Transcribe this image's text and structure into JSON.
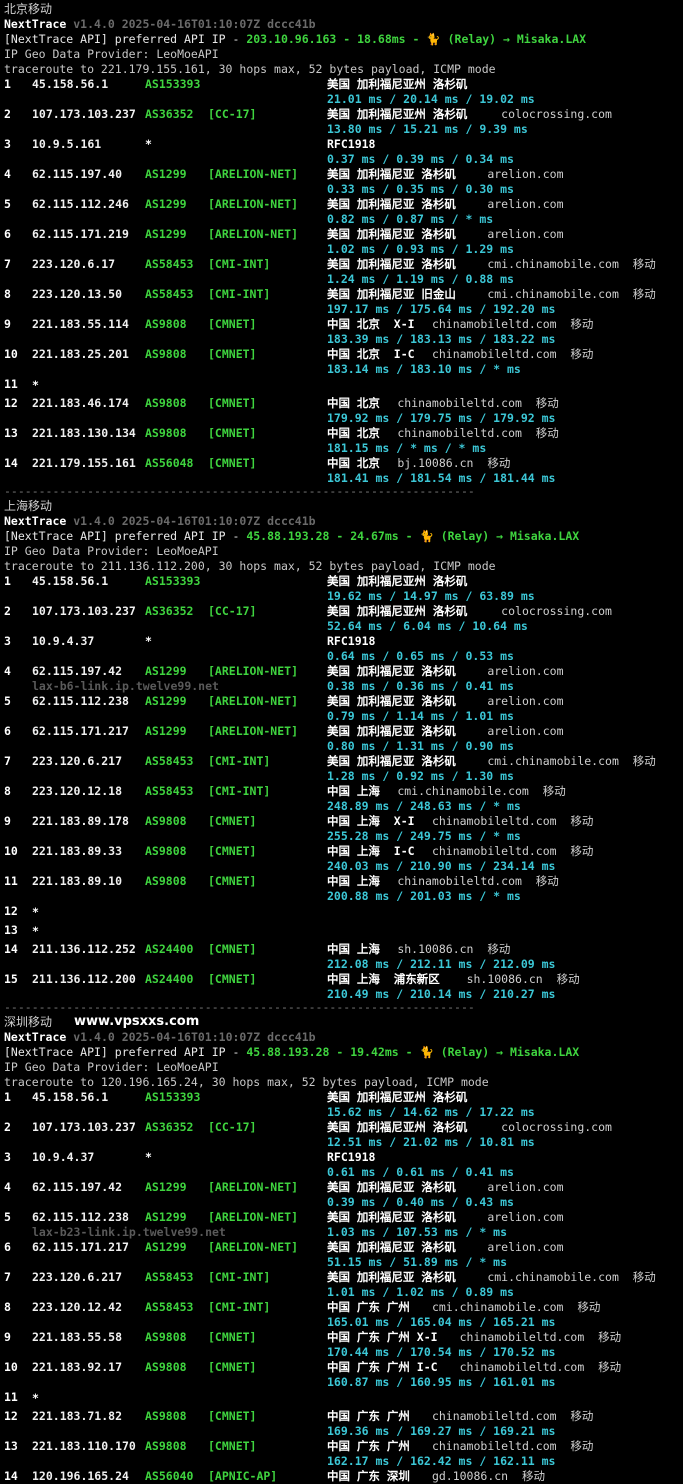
{
  "separator": "-------------------------------------------------------------------------------",
  "watermark": "www.vpsxxs.com",
  "sections": [
    {
      "title": "北京移动",
      "brand": "NextTrace",
      "version": "v1.4.0 2025-04-16T01:10:07Z dccc41b",
      "api_prefix": "[NextTrace API] preferred API IP - ",
      "api_ip": "203.10.96.163",
      "api_latency": "18.68ms",
      "api_route": "(Relay) → Misaka.LAX",
      "geo_provider": "IP Geo Data Provider: LeoMoeAPI",
      "traceroute": "traceroute to 221.179.155.161, 30 hops max, 52 bytes payload, ICMP mode",
      "hops": [
        {
          "n": "1",
          "ip": "45.158.56.1",
          "asn": "AS153393",
          "tag": "",
          "geo": "美国 加利福尼亚州 洛杉矶",
          "dom": "",
          "rtt": "21.01 ms / 20.14 ms / 19.02 ms",
          "rdns": ""
        },
        {
          "n": "2",
          "ip": "107.173.103.237",
          "asn": "AS36352",
          "tag": "[CC-17]",
          "geo": "美国 加利福尼亚州 洛杉矶",
          "dom": "colocrossing.com",
          "rtt": "13.80 ms / 15.21 ms / 9.39 ms",
          "rdns": ""
        },
        {
          "n": "3",
          "ip": "10.9.5.161",
          "asn": "*",
          "tag": "",
          "geo": "RFC1918",
          "dom": "",
          "rtt": "0.37 ms / 0.39 ms / 0.34 ms",
          "rdns": ""
        },
        {
          "n": "4",
          "ip": "62.115.197.40",
          "asn": "AS1299",
          "tag": "[ARELION-NET]",
          "geo": "美国 加利福尼亚 洛杉矶",
          "dom": "arelion.com",
          "rtt": "0.33 ms / 0.35 ms / 0.30 ms",
          "rdns": ""
        },
        {
          "n": "5",
          "ip": "62.115.112.246",
          "asn": "AS1299",
          "tag": "[ARELION-NET]",
          "geo": "美国 加利福尼亚 洛杉矶",
          "dom": "arelion.com",
          "rtt": "0.82 ms / 0.87 ms / * ms",
          "rdns": ""
        },
        {
          "n": "6",
          "ip": "62.115.171.219",
          "asn": "AS1299",
          "tag": "[ARELION-NET]",
          "geo": "美国 加利福尼亚 洛杉矶",
          "dom": "arelion.com",
          "rtt": "1.02 ms / 0.93 ms / 1.29 ms",
          "rdns": ""
        },
        {
          "n": "7",
          "ip": "223.120.6.17",
          "asn": "AS58453",
          "tag": "[CMI-INT]",
          "geo": "美国 加利福尼亚 洛杉矶",
          "dom": "cmi.chinamobile.com  移动",
          "rtt": "1.24 ms / 1.19 ms / 0.88 ms",
          "rdns": ""
        },
        {
          "n": "8",
          "ip": "223.120.13.50",
          "asn": "AS58453",
          "tag": "[CMI-INT]",
          "geo": "美国 加利福尼亚 旧金山",
          "dom": "cmi.chinamobile.com  移动",
          "rtt": "197.17 ms / 175.64 ms / 192.20 ms",
          "rdns": ""
        },
        {
          "n": "9",
          "ip": "221.183.55.114",
          "asn": "AS9808",
          "tag": "[CMNET]",
          "geo": "中国 北京  X-I",
          "dom": "chinamobileltd.com  移动",
          "rtt": "183.39 ms / 183.13 ms / 183.22 ms",
          "rdns": ""
        },
        {
          "n": "10",
          "ip": "221.183.25.201",
          "asn": "AS9808",
          "tag": "[CMNET]",
          "geo": "中国 北京  I-C",
          "dom": "chinamobileltd.com  移动",
          "rtt": "183.14 ms / 183.10 ms / * ms",
          "rdns": ""
        },
        {
          "n": "11",
          "ip": "*",
          "asn": "",
          "tag": "",
          "geo": "",
          "dom": "",
          "rtt": "",
          "rdns": ""
        },
        {
          "n": "12",
          "ip": "221.183.46.174",
          "asn": "AS9808",
          "tag": "[CMNET]",
          "geo": "中国 北京",
          "dom": "chinamobileltd.com  移动",
          "rtt": "179.92 ms / 179.75 ms / 179.92 ms",
          "rdns": ""
        },
        {
          "n": "13",
          "ip": "221.183.130.134",
          "asn": "AS9808",
          "tag": "[CMNET]",
          "geo": "中国 北京",
          "dom": "chinamobileltd.com  移动",
          "rtt": "181.15 ms / * ms / * ms",
          "rdns": ""
        },
        {
          "n": "14",
          "ip": "221.179.155.161",
          "asn": "AS56048",
          "tag": "[CMNET]",
          "geo": "中国 北京",
          "dom": "bj.10086.cn  移动",
          "rtt": "181.41 ms / 181.54 ms / 181.44 ms",
          "rdns": ""
        }
      ]
    },
    {
      "title": "上海移动",
      "brand": "NextTrace",
      "version": "v1.4.0 2025-04-16T01:10:07Z dccc41b",
      "api_prefix": "[NextTrace API] preferred API IP - ",
      "api_ip": "45.88.193.28",
      "api_latency": "24.67ms",
      "api_route": "(Relay) → Misaka.LAX",
      "geo_provider": "IP Geo Data Provider: LeoMoeAPI",
      "traceroute": "traceroute to 211.136.112.200, 30 hops max, 52 bytes payload, ICMP mode",
      "hops": [
        {
          "n": "1",
          "ip": "45.158.56.1",
          "asn": "AS153393",
          "tag": "",
          "geo": "美国 加利福尼亚州 洛杉矶",
          "dom": "",
          "rtt": "19.62 ms / 14.97 ms / 63.89 ms",
          "rdns": ""
        },
        {
          "n": "2",
          "ip": "107.173.103.237",
          "asn": "AS36352",
          "tag": "[CC-17]",
          "geo": "美国 加利福尼亚州 洛杉矶",
          "dom": "colocrossing.com",
          "rtt": "52.64 ms / 6.04 ms / 10.64 ms",
          "rdns": ""
        },
        {
          "n": "3",
          "ip": "10.9.4.37",
          "asn": "*",
          "tag": "",
          "geo": "RFC1918",
          "dom": "",
          "rtt": "0.64 ms / 0.65 ms / 0.53 ms",
          "rdns": ""
        },
        {
          "n": "4",
          "ip": "62.115.197.42",
          "asn": "AS1299",
          "tag": "[ARELION-NET]",
          "geo": "美国 加利福尼亚 洛杉矶",
          "dom": "arelion.com",
          "rtt": "0.38 ms / 0.36 ms / 0.41 ms",
          "rdns": "lax-b6-link.ip.twelve99.net"
        },
        {
          "n": "5",
          "ip": "62.115.112.238",
          "asn": "AS1299",
          "tag": "[ARELION-NET]",
          "geo": "美国 加利福尼亚 洛杉矶",
          "dom": "arelion.com",
          "rtt": "0.79 ms / 1.14 ms / 1.01 ms",
          "rdns": ""
        },
        {
          "n": "6",
          "ip": "62.115.171.217",
          "asn": "AS1299",
          "tag": "[ARELION-NET]",
          "geo": "美国 加利福尼亚 洛杉矶",
          "dom": "arelion.com",
          "rtt": "0.80 ms / 1.31 ms / 0.90 ms",
          "rdns": ""
        },
        {
          "n": "7",
          "ip": "223.120.6.217",
          "asn": "AS58453",
          "tag": "[CMI-INT]",
          "geo": "美国 加利福尼亚 洛杉矶",
          "dom": "cmi.chinamobile.com  移动",
          "rtt": "1.28 ms / 0.92 ms / 1.30 ms",
          "rdns": ""
        },
        {
          "n": "8",
          "ip": "223.120.12.18",
          "asn": "AS58453",
          "tag": "[CMI-INT]",
          "geo": "中国 上海",
          "dom": "cmi.chinamobile.com  移动",
          "rtt": "248.89 ms / 248.63 ms / * ms",
          "rdns": ""
        },
        {
          "n": "9",
          "ip": "221.183.89.178",
          "asn": "AS9808",
          "tag": "[CMNET]",
          "geo": "中国 上海  X-I",
          "dom": "chinamobileltd.com  移动",
          "rtt": "255.28 ms / 249.75 ms / * ms",
          "rdns": ""
        },
        {
          "n": "10",
          "ip": "221.183.89.33",
          "asn": "AS9808",
          "tag": "[CMNET]",
          "geo": "中国 上海  I-C",
          "dom": "chinamobileltd.com  移动",
          "rtt": "240.03 ms / 210.90 ms / 234.14 ms",
          "rdns": ""
        },
        {
          "n": "11",
          "ip": "221.183.89.10",
          "asn": "AS9808",
          "tag": "[CMNET]",
          "geo": "中国 上海",
          "dom": "chinamobileltd.com  移动",
          "rtt": "200.88 ms / 201.03 ms / * ms",
          "rdns": ""
        },
        {
          "n": "12",
          "ip": "*",
          "asn": "",
          "tag": "",
          "geo": "",
          "dom": "",
          "rtt": "",
          "rdns": ""
        },
        {
          "n": "13",
          "ip": "*",
          "asn": "",
          "tag": "",
          "geo": "",
          "dom": "",
          "rtt": "",
          "rdns": ""
        },
        {
          "n": "14",
          "ip": "211.136.112.252",
          "asn": "AS24400",
          "tag": "[CMNET]",
          "geo": "中国 上海",
          "dom": "sh.10086.cn  移动",
          "rtt": "212.08 ms / 212.11 ms / 212.09 ms",
          "rdns": ""
        },
        {
          "n": "15",
          "ip": "211.136.112.200",
          "asn": "AS24400",
          "tag": "[CMNET]",
          "geo": "中国 上海  浦东新区",
          "dom": "sh.10086.cn  移动",
          "rtt": "210.49 ms / 210.14 ms / 210.27 ms",
          "rdns": ""
        }
      ]
    },
    {
      "title": "深圳移动",
      "brand": "NextTrace",
      "version": "v1.4.0 2025-04-16T01:10:07Z dccc41b",
      "api_prefix": "[NextTrace API] preferred API IP - ",
      "api_ip": "45.88.193.28",
      "api_latency": "19.42ms",
      "api_route": "(Relay) → Misaka.LAX",
      "geo_provider": "IP Geo Data Provider: LeoMoeAPI",
      "traceroute": "traceroute to 120.196.165.24, 30 hops max, 52 bytes payload, ICMP mode",
      "hops": [
        {
          "n": "1",
          "ip": "45.158.56.1",
          "asn": "AS153393",
          "tag": "",
          "geo": "美国 加利福尼亚州 洛杉矶",
          "dom": "",
          "rtt": "15.62 ms / 14.62 ms / 17.22 ms",
          "rdns": ""
        },
        {
          "n": "2",
          "ip": "107.173.103.237",
          "asn": "AS36352",
          "tag": "[CC-17]",
          "geo": "美国 加利福尼亚州 洛杉矶",
          "dom": "colocrossing.com",
          "rtt": "12.51 ms / 21.02 ms / 10.81 ms",
          "rdns": ""
        },
        {
          "n": "3",
          "ip": "10.9.4.37",
          "asn": "*",
          "tag": "",
          "geo": "RFC1918",
          "dom": "",
          "rtt": "0.61 ms / 0.61 ms / 0.41 ms",
          "rdns": ""
        },
        {
          "n": "4",
          "ip": "62.115.197.42",
          "asn": "AS1299",
          "tag": "[ARELION-NET]",
          "geo": "美国 加利福尼亚 洛杉矶",
          "dom": "arelion.com",
          "rtt": "0.39 ms / 0.40 ms / 0.43 ms",
          "rdns": ""
        },
        {
          "n": "5",
          "ip": "62.115.112.238",
          "asn": "AS1299",
          "tag": "[ARELION-NET]",
          "geo": "美国 加利福尼亚 洛杉矶",
          "dom": "arelion.com",
          "rtt": "1.03 ms / 107.53 ms / * ms",
          "rdns": "lax-b23-link.ip.twelve99.net"
        },
        {
          "n": "6",
          "ip": "62.115.171.217",
          "asn": "AS1299",
          "tag": "[ARELION-NET]",
          "geo": "美国 加利福尼亚 洛杉矶",
          "dom": "arelion.com",
          "rtt": "51.15 ms / 51.89 ms / * ms",
          "rdns": ""
        },
        {
          "n": "7",
          "ip": "223.120.6.217",
          "asn": "AS58453",
          "tag": "[CMI-INT]",
          "geo": "美国 加利福尼亚 洛杉矶",
          "dom": "cmi.chinamobile.com  移动",
          "rtt": "1.01 ms / 1.02 ms / 0.89 ms",
          "rdns": ""
        },
        {
          "n": "8",
          "ip": "223.120.12.42",
          "asn": "AS58453",
          "tag": "[CMI-INT]",
          "geo": "中国 广东 广州",
          "dom": "cmi.chinamobile.com  移动",
          "rtt": "165.01 ms / 165.04 ms / 165.21 ms",
          "rdns": ""
        },
        {
          "n": "9",
          "ip": "221.183.55.58",
          "asn": "AS9808",
          "tag": "[CMNET]",
          "geo": "中国 广东 广州 X-I",
          "dom": "chinamobileltd.com  移动",
          "rtt": "170.44 ms / 170.54 ms / 170.52 ms",
          "rdns": ""
        },
        {
          "n": "10",
          "ip": "221.183.92.17",
          "asn": "AS9808",
          "tag": "[CMNET]",
          "geo": "中国 广东 广州 I-C",
          "dom": "chinamobileltd.com  移动",
          "rtt": "160.87 ms / 160.95 ms / 161.01 ms",
          "rdns": ""
        },
        {
          "n": "11",
          "ip": "*",
          "asn": "",
          "tag": "",
          "geo": "",
          "dom": "",
          "rtt": "",
          "rdns": ""
        },
        {
          "n": "12",
          "ip": "221.183.71.82",
          "asn": "AS9808",
          "tag": "[CMNET]",
          "geo": "中国 广东 广州",
          "dom": "chinamobileltd.com  移动",
          "rtt": "169.36 ms / 169.27 ms / 169.21 ms",
          "rdns": ""
        },
        {
          "n": "13",
          "ip": "221.183.110.170",
          "asn": "AS9808",
          "tag": "[CMNET]",
          "geo": "中国 广东 广州",
          "dom": "chinamobileltd.com  移动",
          "rtt": "162.17 ms / 162.42 ms / 162.11 ms",
          "rdns": ""
        },
        {
          "n": "14",
          "ip": "120.196.165.24",
          "asn": "AS56040",
          "tag": "[APNIC-AP]",
          "geo": "中国 广东 深圳",
          "dom": "gd.10086.cn  移动",
          "rtt": "",
          "rdns": ""
        }
      ]
    }
  ]
}
